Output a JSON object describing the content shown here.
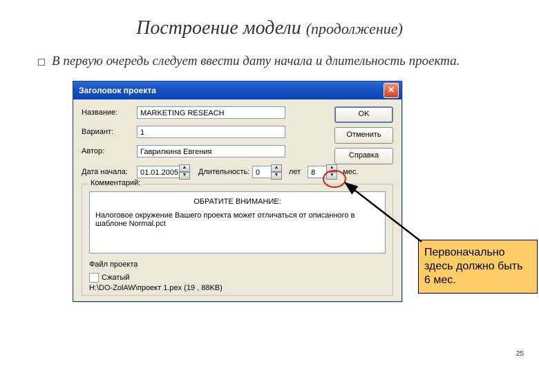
{
  "slide": {
    "title_main": "Построение модели",
    "title_sub": "(продолжение)",
    "body_prefix": "В  первую очередь следует ввести ",
    "body_emph": "дату начала и длительность проекта.",
    "page_number": "25"
  },
  "dialog": {
    "titlebar": "Заголовок проекта",
    "close_glyph": "✕",
    "labels": {
      "name": "Название:",
      "variant": "Вариант:",
      "author": "Автор:",
      "start_date": "Дата начала:",
      "duration": "Длительность:",
      "years_unit": "лет",
      "months_unit": "мес.",
      "comment": "Комментарий:",
      "file_project": "Файл проекта",
      "compressed": "Сжатый"
    },
    "values": {
      "name": "MARKETING RESEACH",
      "variant": "1",
      "author": "Гаврилкина Евгения",
      "start_date": "01.01.2005",
      "years": "0",
      "months": "8",
      "file_path": "H:\\DO-ZolAW\\проект 1.pex (19 , 88KB)"
    },
    "notice": {
      "title": "ОБРАТИТЕ ВНИМАНИЕ:",
      "text": "Налоговое окружение Вашего проекта может отличаться от описанного в шаблоне Normal.pct"
    },
    "buttons": {
      "ok": "OK",
      "cancel": "Отменить",
      "help": "Справка"
    }
  },
  "callout": {
    "text": "Первоначально здесь должно быть 6 мес."
  }
}
